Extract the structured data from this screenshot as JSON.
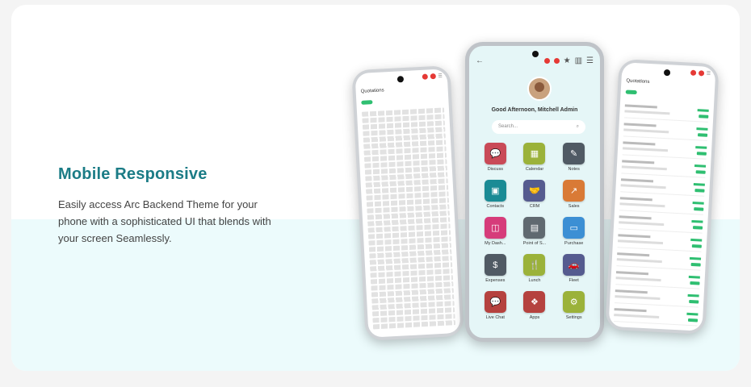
{
  "heading": "Mobile Responsive",
  "description": "Easily access Arc Backend Theme for your phone with a sophisticated UI that blends with your screen Seamlessly.",
  "center_phone": {
    "greeting": "Good Afternoon, Mitchell Admin",
    "search_placeholder": "Search...",
    "apps": [
      {
        "label": "Discuss",
        "color": "#c94a57",
        "icon": "chat-icon",
        "glyph": "💬"
      },
      {
        "label": "Calendar",
        "color": "#9bb23a",
        "icon": "calendar-icon",
        "glyph": "▦"
      },
      {
        "label": "Notes",
        "color": "#505a64",
        "icon": "notes-icon",
        "glyph": "✎"
      },
      {
        "label": "Contacts",
        "color": "#1a8b95",
        "icon": "contacts-icon",
        "glyph": "▣"
      },
      {
        "label": "CRM",
        "color": "#555b8f",
        "icon": "handshake-icon",
        "glyph": "🤝"
      },
      {
        "label": "Sales",
        "color": "#d97a36",
        "icon": "chart-up-icon",
        "glyph": "↗"
      },
      {
        "label": "My Dash...",
        "color": "#d63c7a",
        "icon": "dashboard-icon",
        "glyph": "◫"
      },
      {
        "label": "Point of S...",
        "color": "#606970",
        "icon": "store-icon",
        "glyph": "▤"
      },
      {
        "label": "Purchase",
        "color": "#3c8fd4",
        "icon": "card-icon",
        "glyph": "▭"
      },
      {
        "label": "Expenses",
        "color": "#505a64",
        "icon": "expenses-icon",
        "glyph": "$"
      },
      {
        "label": "Lunch",
        "color": "#9bb23a",
        "icon": "cutlery-icon",
        "glyph": "🍴"
      },
      {
        "label": "Fleet",
        "color": "#555b8f",
        "icon": "car-icon",
        "glyph": "🚗"
      },
      {
        "label": "Live Chat",
        "color": "#b5423f",
        "icon": "live-chat-icon",
        "glyph": "💬"
      },
      {
        "label": "Apps",
        "color": "#b5423f",
        "icon": "apps-icon",
        "glyph": "❖"
      },
      {
        "label": "Settings",
        "color": "#9bb23a",
        "icon": "gear-icon",
        "glyph": "⚙"
      }
    ]
  },
  "left_phone": {
    "title": "Quotations"
  },
  "right_phone": {
    "title": "Quotations"
  }
}
